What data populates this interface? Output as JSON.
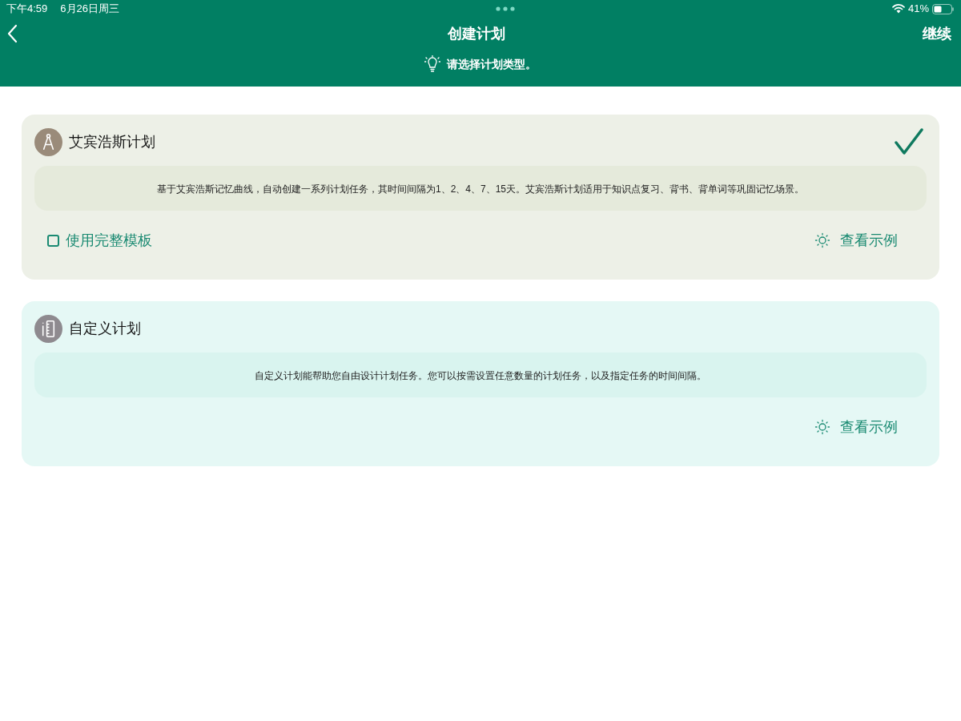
{
  "status_bar": {
    "time": "下午4:59",
    "date": "6月26日周三",
    "battery": "41%"
  },
  "nav": {
    "title": "创建计划",
    "action": "继续"
  },
  "hint": "请选择计划类型。",
  "plans": [
    {
      "kind": "ebbinghaus",
      "title": "艾宾浩斯计划",
      "selected": true,
      "description": "基于艾宾浩斯记忆曲线，自动创建一系列计划任务，其时间间隔为1、2、4、7、15天。艾宾浩斯计划适用于知识点复习、背书、背单词等巩固记忆场景。",
      "option": {
        "label": "使用完整模板",
        "checked": false
      },
      "example": "查看示例"
    },
    {
      "kind": "custom",
      "title": "自定义计划",
      "selected": false,
      "description": "自定义计划能帮助您自由设计计划任务。您可以按需设置任意数量的计划任务，以及指定任务的时间间隔。",
      "example": "查看示例"
    }
  ]
}
